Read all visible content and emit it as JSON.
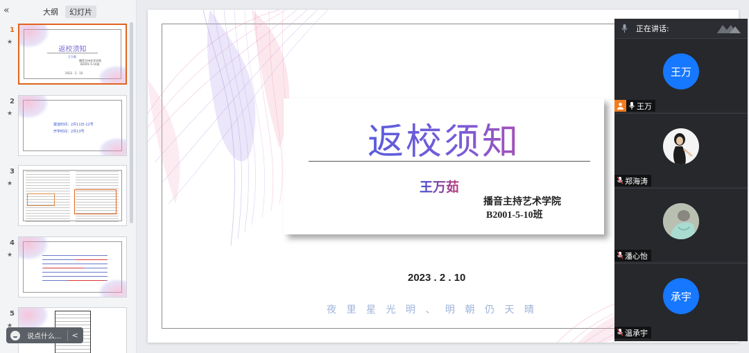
{
  "left_panel": {
    "tabs": [
      {
        "label": "大纲",
        "active": false
      },
      {
        "label": "幻灯片",
        "active": true
      }
    ],
    "thumbnails": [
      {
        "number": "1",
        "active": true,
        "title": "返校须知",
        "author": "王万茹",
        "school": "播音主持艺术学院",
        "class_name": "B2001-5-10班",
        "date": "2023 . 2 . 10"
      },
      {
        "number": "2",
        "active": false,
        "lines": [
          "报道时间：2月11日-12号",
          "开学时间：2月13号"
        ]
      },
      {
        "number": "3",
        "active": false
      },
      {
        "number": "4",
        "active": false
      },
      {
        "number": "5",
        "active": false
      }
    ],
    "chat_placeholder": "说点什么..."
  },
  "slide": {
    "title": "返校须知",
    "author": "王万茹",
    "school": "播音主持艺术学院",
    "class_name": "B2001-5-10班",
    "date": "2023 . 2 . 10",
    "poem": "夜里星光明、明朝仍天晴"
  },
  "video_panel": {
    "speaking_label": "正在讲话:",
    "participants": [
      {
        "name": "王万",
        "avatar_text": "王万",
        "host": true,
        "avatar_type": "initials"
      },
      {
        "name": "郑海涛",
        "avatar_type": "photo"
      },
      {
        "name": "潘心怡",
        "avatar_type": "photo"
      },
      {
        "name": "温承宇",
        "avatar_text": "承宇",
        "avatar_type": "initials"
      }
    ]
  },
  "colors": {
    "accent_orange": "#e0631d",
    "avatar_blue": "#1677ff",
    "panel_dark": "#2b2d32",
    "title_gradient_start": "#3c5de0",
    "title_gradient_end": "#e0448a"
  },
  "icons": [
    "collapse-icon",
    "star-icon",
    "chat-emoji-icon",
    "chevron-left-icon",
    "microphone-icon",
    "host-person-icon",
    "app-logo-icon"
  ]
}
